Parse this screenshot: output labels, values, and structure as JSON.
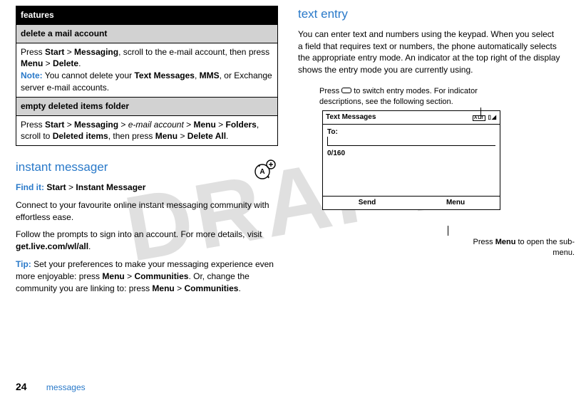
{
  "watermark": "DRAFT",
  "table": {
    "header": "features",
    "row1_head": "delete a mail account",
    "row1_a": "Press ",
    "row1_b": "Start",
    "row1_c": " > ",
    "row1_d": "Messaging",
    "row1_e": ", scroll to the e-mail account, then press ",
    "row1_f": "Menu",
    "row1_g": " > ",
    "row1_h": "Delete",
    "row1_i": ".",
    "row1_note_label": "Note:",
    "row1_note_a": " You cannot delete your ",
    "row1_note_b": "Text Messages",
    "row1_note_c": ", ",
    "row1_note_d": "MMS",
    "row1_note_e": ", or Exchange server e-mail accounts.",
    "row2_head": "empty deleted items folder",
    "row2_a": "Press ",
    "row2_b": "Start",
    "row2_c": " > ",
    "row2_d": "Messaging",
    "row2_e": " > ",
    "row2_em": "e-mail account",
    "row2_f": " > ",
    "row2_g": "Menu",
    "row2_h": " > ",
    "row2_i": "Folders",
    "row2_j": ", scroll to ",
    "row2_k": "Deleted items",
    "row2_l": ", then press ",
    "row2_m": "Menu",
    "row2_n": " > ",
    "row2_o": "Delete All",
    "row2_p": "."
  },
  "im": {
    "heading": "instant messager",
    "findit": "Find it:",
    "findit_a": " ",
    "findit_b": "Start",
    "findit_c": " > ",
    "findit_d": "Instant Messager",
    "p1": "Connect to your favourite online instant messaging community with effortless ease.",
    "p2_a": "Follow the prompts to sign into an account. For more details, visit ",
    "p2_b": "get.live.com/wl/all",
    "p2_c": ".",
    "tip_label": "Tip:",
    "tip_a": " Set your preferences to make your messaging experience even more enjoyable: press ",
    "tip_b": "Menu",
    "tip_c": " > ",
    "tip_d": "Communities",
    "tip_e": ". Or, change the community you are linking to: press ",
    "tip_f": "Menu",
    "tip_g": " > ",
    "tip_h": "Communities",
    "tip_i": "."
  },
  "te": {
    "heading": "text entry",
    "p1": "You can enter text and numbers using the keypad. When you select a field that requires text or numbers, the phone automatically selects the appropriate entry mode. An indicator at the top right of the display shows the entry mode you are currently using.",
    "cap_top_a": "Press ",
    "cap_top_b": " to switch entry modes. For indicator descriptions, see the following section.",
    "cap_bot_a": "Press ",
    "cap_bot_b": "Menu",
    "cap_bot_c": " to open the sub-menu."
  },
  "phone": {
    "title": "Text Messages",
    "icons_alt": "ALT",
    "to": "To:",
    "count": "0/160",
    "soft_left": "Send",
    "soft_right": "Menu"
  },
  "footer": {
    "page": "24",
    "section": "messages"
  }
}
